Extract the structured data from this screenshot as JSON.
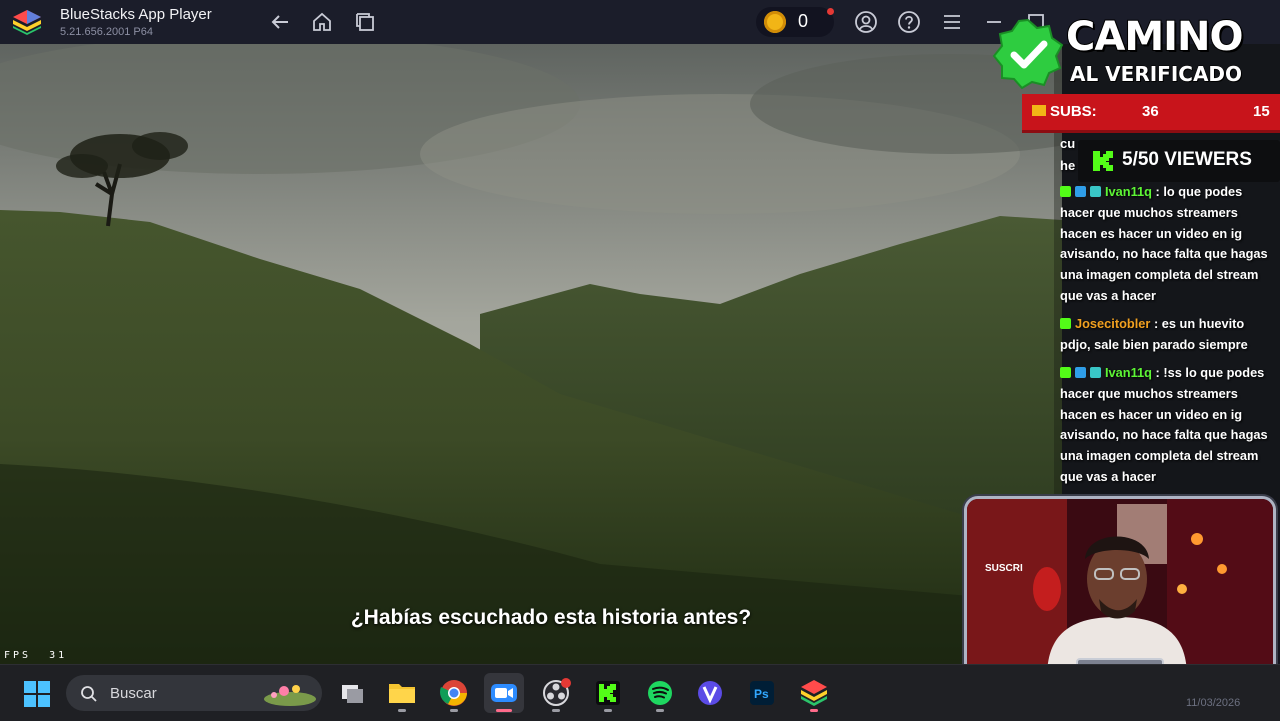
{
  "titlebar": {
    "app_name": "BlueStacks App Player",
    "version": "5.21.656.2001 P64",
    "coins": "0",
    "icons": [
      "back-icon",
      "home-icon",
      "recent-apps-icon",
      "account-icon",
      "help-icon",
      "menu-icon",
      "minimize-icon",
      "maximize-icon",
      "close-icon"
    ]
  },
  "video": {
    "subtitle": "¿Habías escuchado esta historia antes?",
    "fps_label": "FPS",
    "fps_value": "31"
  },
  "overlay": {
    "brand_line1": "CAMINO",
    "brand_line2": "AL VERIFICADO",
    "subs_label": "SUBS:",
    "subs_count": "36",
    "subs_goal": "15",
    "viewers": "5/50 VIEWERS",
    "chat_fragment_1": "cu",
    "chat_fragment_2": "he",
    "chat": [
      {
        "user": "Ivan11q",
        "badges": [
          "kick",
          "blue",
          "teal"
        ],
        "user_color": "green",
        "text": ": lo que podes hacer que muchos streamers hacen es hacer un video en ig avisando, no hace falta que hagas una imagen completa del stream que vas a hacer"
      },
      {
        "user": "Josecitobler",
        "badges": [
          "kick"
        ],
        "user_color": "orange",
        "text": ": es un huevito pdjo, sale bien parado siempre"
      },
      {
        "user": "Ivan11q",
        "badges": [
          "kick",
          "blue",
          "teal"
        ],
        "user_color": "green",
        "text": ": !ss lo que podes hacer que muchos streamers hacen es hacer un video en ig avisando, no hace falta que hagas una imagen completa del stream que vas a hacer"
      }
    ],
    "webcam_sign": "SUSCRI"
  },
  "taskbar": {
    "search_placeholder": "Buscar",
    "apps": [
      "task-view",
      "file-explorer",
      "chrome",
      "zoom",
      "obs",
      "kick",
      "spotify",
      "v-app",
      "photoshop",
      "bluestacks"
    ],
    "active_app": "zoom",
    "date": "11/03/2026"
  }
}
